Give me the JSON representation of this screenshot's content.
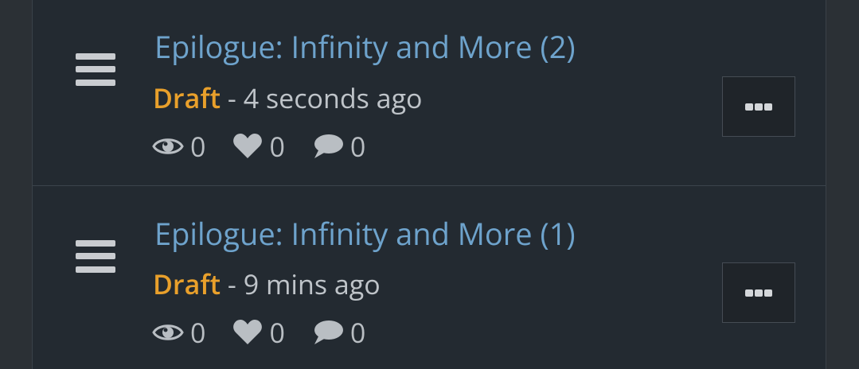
{
  "posts": [
    {
      "title": "Epilogue: Infinity and More (2)",
      "status": "Draft",
      "separator": " - ",
      "time": "4 seconds ago",
      "views": "0",
      "likes": "0",
      "comments": "0"
    },
    {
      "title": "Epilogue: Infinity and More (1)",
      "status": "Draft",
      "separator": " - ",
      "time": "9 mins ago",
      "views": "0",
      "likes": "0",
      "comments": "0"
    }
  ],
  "icons": {
    "drag": "hamburger-drag-icon",
    "views": "eye-icon",
    "likes": "heart-icon",
    "comments": "speech-bubble-icon",
    "more": "ellipsis-icon"
  },
  "colors": {
    "title": "#6ea3cc",
    "status_draft": "#e9a02b",
    "text": "#bfc4c9",
    "background": "#232a31"
  }
}
